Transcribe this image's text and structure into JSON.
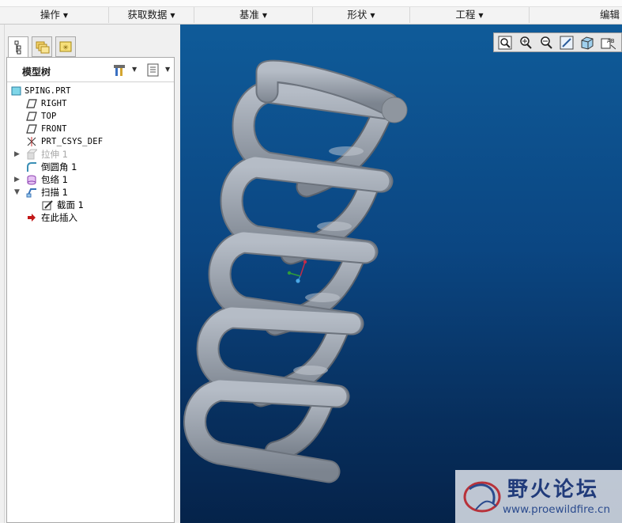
{
  "ribbon": {
    "groups": [
      {
        "label": "操作"
      },
      {
        "label": "获取数据"
      },
      {
        "label": "基准"
      },
      {
        "label": "形状"
      },
      {
        "label": "工程"
      },
      {
        "label": "编辑"
      }
    ]
  },
  "panel": {
    "tabs": [
      {
        "name": "model-tree"
      },
      {
        "name": "folder-browser"
      },
      {
        "name": "favorites"
      }
    ],
    "tree_title": "模型树"
  },
  "tree": {
    "root": "SPING.PRT",
    "items": [
      {
        "label": "RIGHT"
      },
      {
        "label": "TOP"
      },
      {
        "label": "FRONT"
      },
      {
        "label": "PRT_CSYS_DEF"
      },
      {
        "label": "拉伸 1"
      },
      {
        "label": "倒圆角 1"
      },
      {
        "label": "包络 1"
      },
      {
        "label": "扫描 1"
      },
      {
        "label": "截面 1"
      },
      {
        "label": "在此插入"
      }
    ]
  },
  "viewport": {
    "background_top": "#0f5b99",
    "background_bottom": "#05234a",
    "tools": [
      {
        "icon": "refit-icon"
      },
      {
        "icon": "zoom-in-icon"
      },
      {
        "icon": "zoom-out-icon"
      },
      {
        "icon": "repaint-icon"
      },
      {
        "icon": "display-style-icon"
      },
      {
        "icon": "annotation-display-icon"
      }
    ]
  },
  "watermark": {
    "text": "野火论坛",
    "url": "www.proewildfire.cn"
  }
}
